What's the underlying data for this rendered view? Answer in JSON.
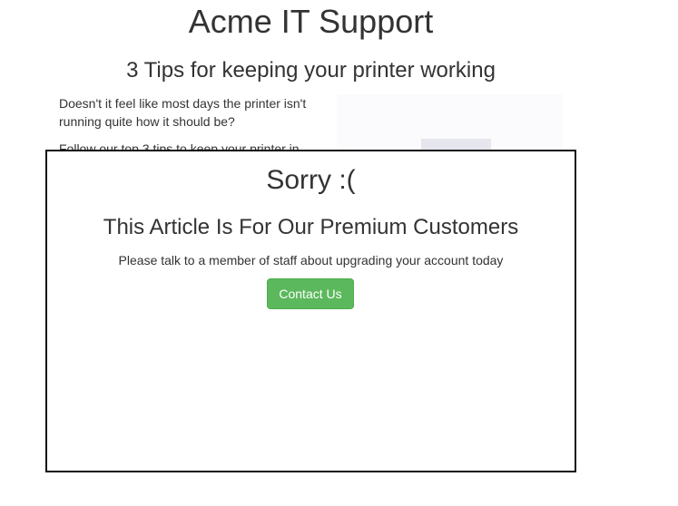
{
  "site": {
    "title": "Acme IT Support"
  },
  "article": {
    "title": "3 Tips for keeping your printer working",
    "paragraphs": [
      "Doesn't it feel like most days the printer isn't running quite how it should be?",
      "Follow our top 3 tips to keep your printer in"
    ]
  },
  "paywall": {
    "heading": "Sorry :(",
    "subheading": "This Article Is For Our Premium Customers",
    "message": "Please talk to a member of staff about upgrading your account today",
    "button_label": "Contact Us"
  },
  "colors": {
    "button_bg": "#5cb85c",
    "border": "#111111",
    "text": "#333333"
  }
}
